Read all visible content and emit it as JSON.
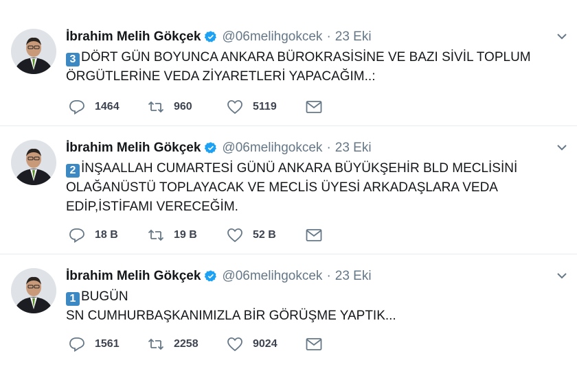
{
  "tweets": [
    {
      "author": "İbrahim Melih Gökçek",
      "handle": "@06melihgokcek",
      "separator": "·",
      "time": "23 Eki",
      "keycap": "3",
      "lines": [
        "DÖRT GÜN BOYUNCA ANKARA BÜROKRASİSİNE VE BAZI SİVİL TOPLUM",
        "ÖRGÜTLERİNE VEDA ZİYARETLERİ YAPACAĞIM..:"
      ],
      "replies": "1464",
      "retweets": "960",
      "likes": "5119"
    },
    {
      "author": "İbrahim Melih Gökçek",
      "handle": "@06melihgokcek",
      "separator": "·",
      "time": "23 Eki",
      "keycap": "2",
      "lines": [
        "İNŞAALLAH CUMARTESİ GÜNÜ ANKARA BÜYÜKŞEHİR BLD MECLİSİNİ",
        "OLAĞANÜSTÜ TOPLAYACAK VE MECLİS ÜYESİ ARKADAŞLARA VEDA",
        "EDİP,İSTİFAMI VERECEĞİM."
      ],
      "replies": "18 B",
      "retweets": "19 B",
      "likes": "52 B"
    },
    {
      "author": "İbrahim Melih Gökçek",
      "handle": "@06melihgokcek",
      "separator": "·",
      "time": "23 Eki",
      "keycap": "1",
      "lines": [
        "BUGÜN",
        "SN CUMHURBAŞKANIMIZLA BİR GÖRÜŞME YAPTIK..."
      ],
      "replies": "1561",
      "retweets": "2258",
      "likes": "9024"
    }
  ],
  "icons": {
    "reply": "reply-icon",
    "retweet": "retweet-icon",
    "like": "heart-icon",
    "dm": "envelope-icon",
    "menu": "chevron-down-icon",
    "verified": "verified-badge-icon"
  },
  "colors": {
    "verified": "#1da1f2",
    "keycap": "#3b88c3",
    "muted": "#657786"
  }
}
